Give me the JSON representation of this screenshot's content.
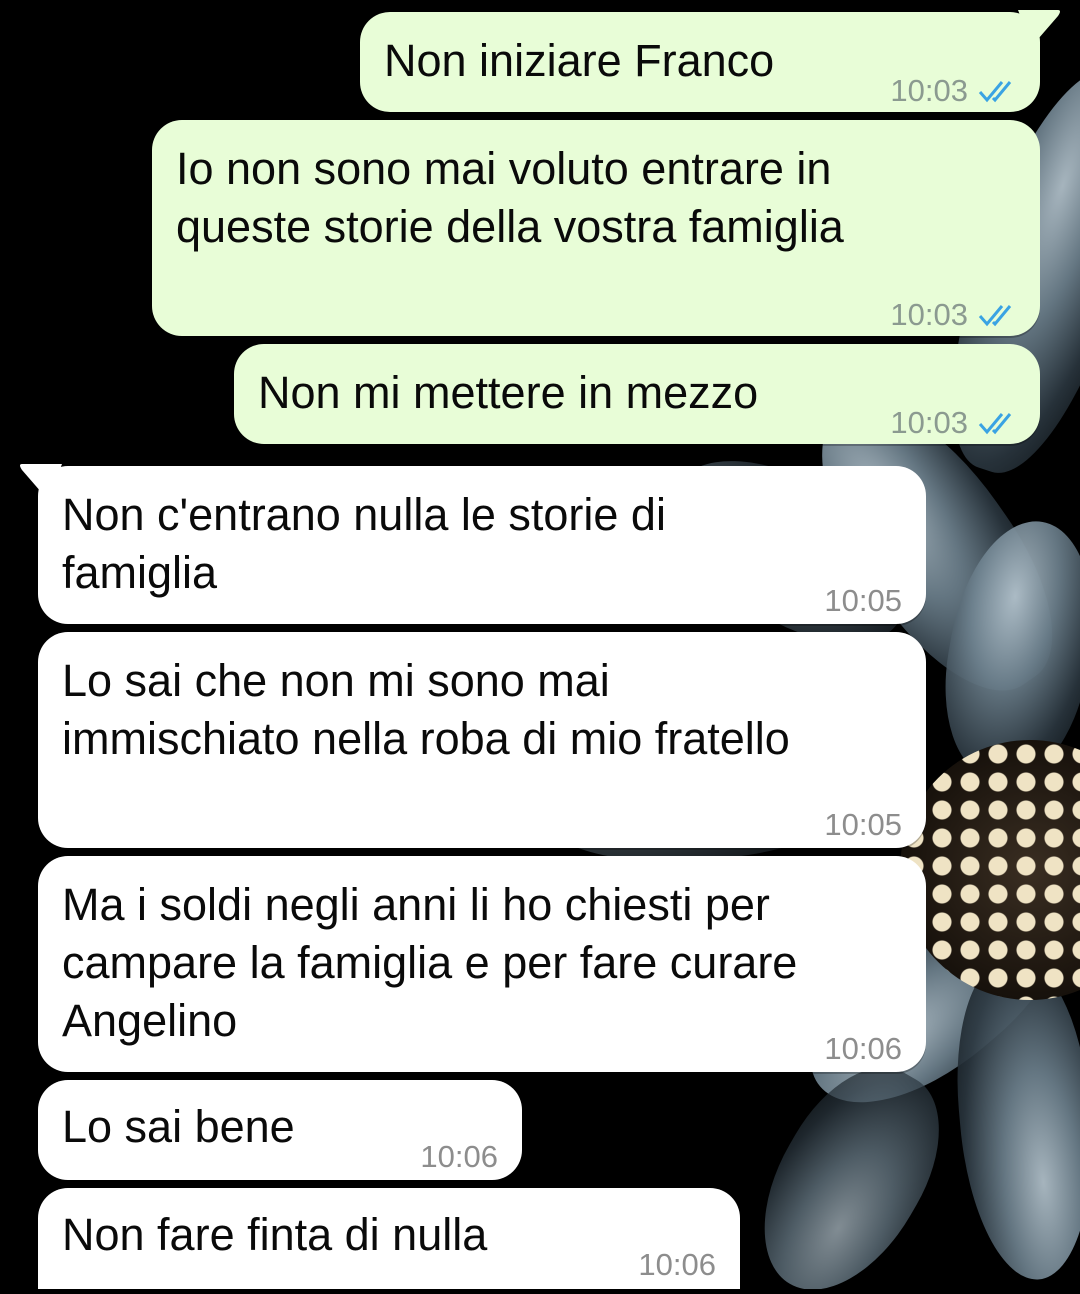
{
  "messages": [
    {
      "direction": "outgoing",
      "text": "Non iniziare Franco",
      "time": "10:03",
      "status": "read-ticks-icon"
    },
    {
      "direction": "outgoing",
      "text": "Io non sono mai voluto entrare in\nqueste storie della vostra famiglia",
      "time": "10:03",
      "status": "read-ticks-icon"
    },
    {
      "direction": "outgoing",
      "text": "Non mi mettere in mezzo",
      "time": "10:03",
      "status": "read-ticks-icon"
    },
    {
      "direction": "incoming",
      "text": "Non c'entrano nulla le storie di\nfamiglia",
      "time": "10:05"
    },
    {
      "direction": "incoming",
      "text": "Lo sai che non mi sono mai\nimmischiato nella roba di mio fratello",
      "time": "10:05"
    },
    {
      "direction": "incoming",
      "text": "Ma i soldi negli anni li ho chiesti per\ncampare la famiglia e per fare curare\nAngelino",
      "time": "10:06"
    },
    {
      "direction": "incoming",
      "text": "Lo sai bene",
      "time": "10:06"
    },
    {
      "direction": "incoming",
      "text": "Non fare finta di nulla",
      "time": "10:06"
    }
  ],
  "colors": {
    "outgoing_bubble": "#e8fdd7",
    "incoming_bubble": "#ffffff",
    "read_ticks": "#3aa3e3",
    "wallpaper": "#000000"
  }
}
